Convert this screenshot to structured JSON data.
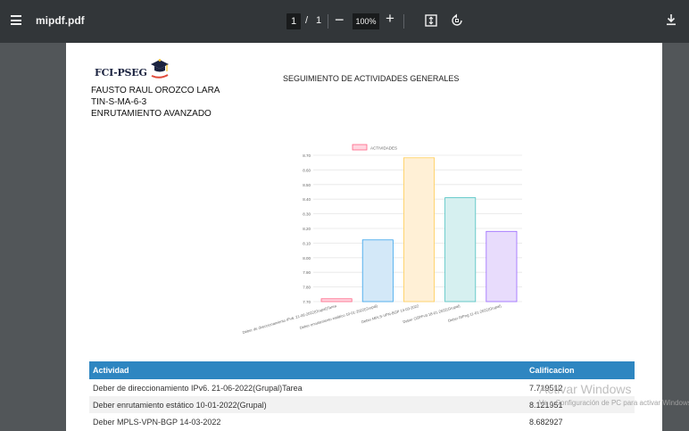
{
  "toolbar": {
    "file_name": "mipdf.pdf",
    "current_page": "1",
    "page_separator": "/",
    "total_pages": "1",
    "zoom_out": "−",
    "zoom": "100%",
    "zoom_in": "+",
    "icons": [
      "menu-icon",
      "fit-page-icon",
      "rotate-icon",
      "download-icon"
    ]
  },
  "document": {
    "logo_text": "FCI-PSEG",
    "title": "SEGUIMIENTO DE ACTIVIDADES GENERALES",
    "student_name": "FAUSTO RAUL OROZCO LARA",
    "student_code": "TIN-S-MA-6-3",
    "course": "ENRUTAMIENTO AVANZADO"
  },
  "chart_data": {
    "type": "bar",
    "legend": [
      "ACTIVIDADES"
    ],
    "legend_position": "top",
    "categories": [
      "Deber de direccionamiento IPv6. 21-06-2022(Grupal)Tarea",
      "Deber enrutamiento estático 10-01-2022(Grupal)",
      "Deber MPLS-VPN-BGP 14-03-2022",
      "Deber OSPFv3 18-01-2022(Grupal)",
      "Deber RIPng 11-01-2022(Grupal)"
    ],
    "values": [
      7.719512,
      8.121951,
      8.682927,
      8.41,
      8.18
    ],
    "ylim": [
      7.7,
      8.7
    ],
    "yticks": [
      "8.70",
      "8.60",
      "8.50",
      "8.40",
      "8.30",
      "8.20",
      "8.10",
      "8.00",
      "7.90",
      "7.80",
      "7.70"
    ],
    "fill_colors": [
      "#ffd6e0",
      "#d3e8f8",
      "#fff0d6",
      "#d6f0f0",
      "#e8dcfc"
    ],
    "border_colors": [
      "#ff6384",
      "#36a2eb",
      "#ffcd56",
      "#4bc0c0",
      "#9966ff"
    ],
    "grid": true
  },
  "table": {
    "headers": {
      "activity": "Actividad",
      "grade": "Calificacion"
    },
    "rows": [
      {
        "activity": "Deber de direccionamiento IPv6. 21-06-2022(Grupal)Tarea",
        "grade": "7.719512"
      },
      {
        "activity": "Deber enrutamiento estático 10-01-2022(Grupal)",
        "grade": "8.121951"
      },
      {
        "activity": "Deber MPLS-VPN-BGP 14-03-2022",
        "grade": "8.682927"
      }
    ]
  },
  "watermark": {
    "title": "Activar Windows",
    "subtitle": "Ve a Configuración de PC para activar Windows."
  },
  "colors": {
    "toolbar_bg": "#323639",
    "viewer_bg": "#525659",
    "table_header": "#2e86c1"
  }
}
